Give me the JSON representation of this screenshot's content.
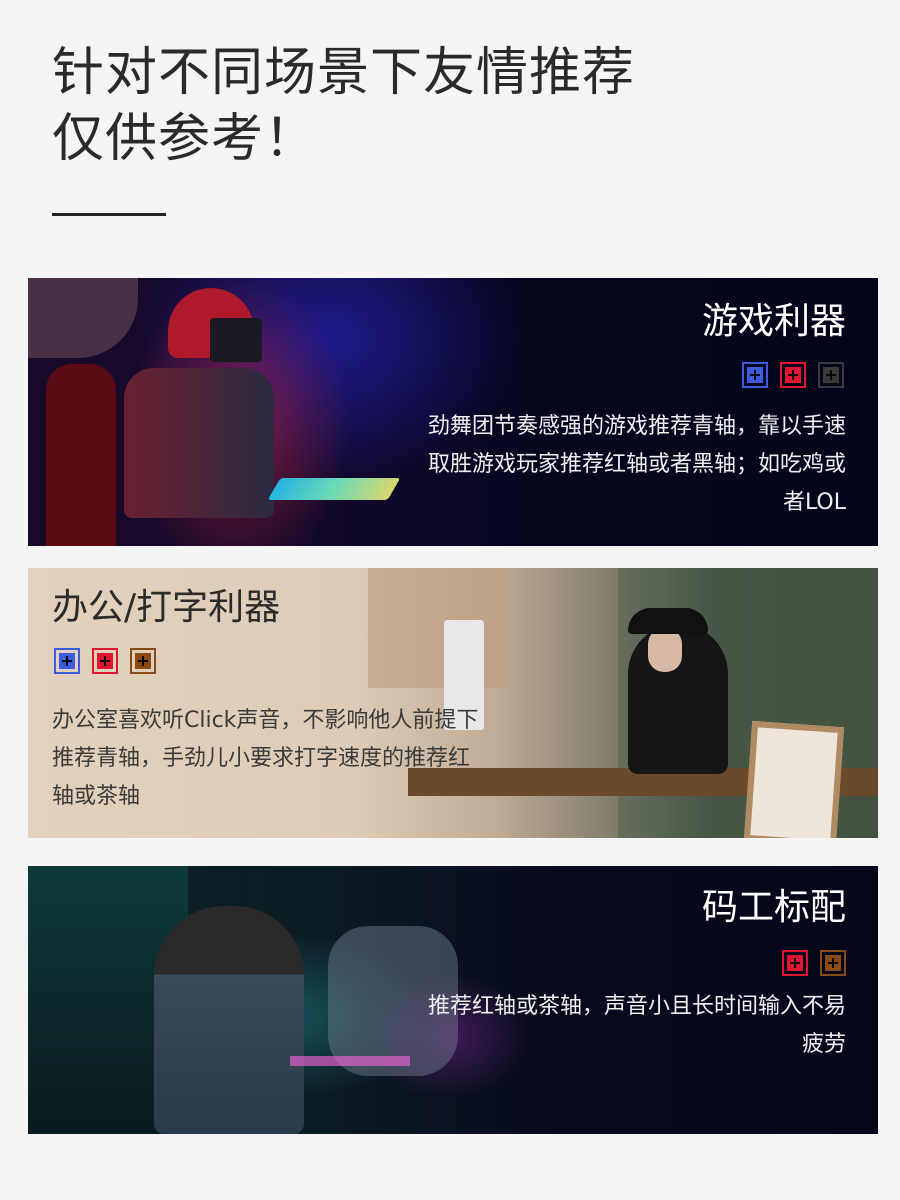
{
  "heading": {
    "line1": "针对不同场景下友情推荐",
    "line2": "仅供参考！"
  },
  "cards": {
    "gaming": {
      "title": "游戏利器",
      "desc": "劲舞团节奏感强的游戏推荐青轴，靠以手速取胜游戏玩家推荐红轴或者黑轴；如吃鸡或者LOL",
      "swatches": [
        "blue",
        "red",
        "black"
      ]
    },
    "office": {
      "title": "办公/打字利器",
      "desc": "办公室喜欢听Click声音，不影响他人前提下推荐青轴，手劲儿小要求打字速度的推荐红轴或茶轴",
      "swatches": [
        "blue",
        "red",
        "brown"
      ]
    },
    "coder": {
      "title": "码工标配",
      "desc": "推荐红轴或茶轴，声音小且长时间输入不易疲劳",
      "swatches": [
        "red",
        "brown"
      ]
    }
  },
  "colors": {
    "blue": "#3b5be0",
    "red": "#e01530",
    "black": "#3a3a3a",
    "brown": "#8a4a16"
  }
}
